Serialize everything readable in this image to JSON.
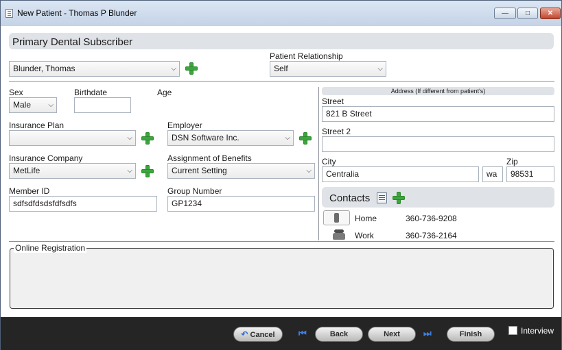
{
  "window": {
    "title": "New Patient - Thomas P Blunder",
    "minimize_glyph": "—",
    "maximize_glyph": "□",
    "close_glyph": "✕"
  },
  "primary": {
    "header": "Primary Dental Subscriber",
    "subscriber_value": "Blunder, Thomas",
    "relationship_label": "Patient Relationship",
    "relationship_value": "Self"
  },
  "patient": {
    "sex_label": "Sex",
    "sex_value": "Male",
    "birthdate_label": "Birthdate",
    "birthdate_value": "",
    "age_label": "Age"
  },
  "insurance": {
    "plan_label": "Insurance Plan",
    "plan_value": "",
    "employer_label": "Employer",
    "employer_value": "DSN Software Inc.",
    "company_label": "Insurance Company",
    "company_value": "MetLife",
    "benefits_label": "Assignment of Benefits",
    "benefits_value": "Current Setting",
    "member_label": "Member ID",
    "member_value": "sdfsdfdsdsfdfsdfs",
    "group_label": "Group Number",
    "group_value": "GP1234"
  },
  "address": {
    "header": "Address (If different from patient's)",
    "street_label": "Street",
    "street_value": "821 B Street",
    "street2_label": "Street 2",
    "street2_value": "",
    "city_label": "City",
    "city_value": "Centralia",
    "state_value": "wa",
    "zip_label": "Zip",
    "zip_value": "98531"
  },
  "contacts": {
    "header": "Contacts",
    "items": [
      {
        "type": "Home",
        "number": "360-736-9208",
        "icon": "home-phone-icon"
      },
      {
        "type": "Work",
        "number": "360-736-2164",
        "icon": "work-phone-icon"
      }
    ]
  },
  "online_registration": {
    "title": "Online Registration"
  },
  "footer": {
    "cancel_label": "Cancel",
    "back_label": "Back",
    "next_label": "Next",
    "finish_label": "Finish",
    "interview_label": "Interview",
    "interview_checked": false,
    "first_glyph": "⏮",
    "last_glyph": "⏭"
  },
  "colors": {
    "accent_green": "#3da53d",
    "header_gray": "#dfe2e6",
    "footer_bg": "#252525"
  }
}
